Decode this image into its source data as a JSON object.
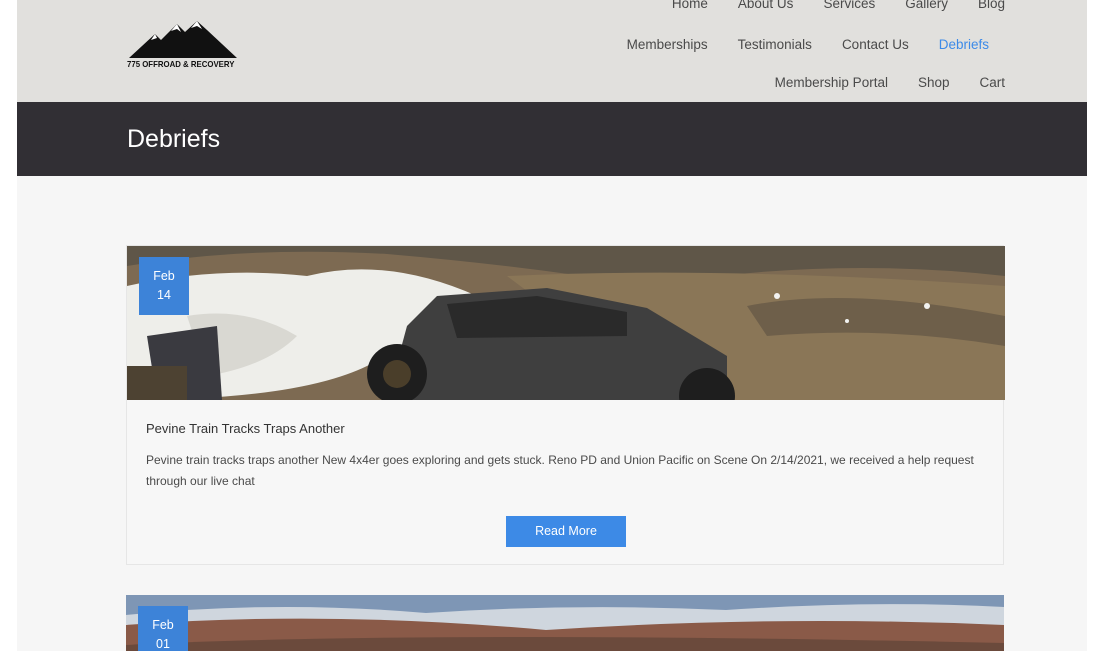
{
  "logo": {
    "text": "775 OFFROAD & RECOVERY"
  },
  "nav": {
    "row1": [
      "Home",
      "About Us",
      "Services",
      "Gallery",
      "Blog"
    ],
    "row2": [
      "Memberships",
      "Testimonials",
      "Contact Us",
      "Debriefs"
    ],
    "row3": [
      "Membership Portal",
      "Shop",
      "Cart"
    ],
    "active": "Debriefs"
  },
  "page_title": "Debriefs",
  "posts": [
    {
      "month": "Feb",
      "day": "14",
      "title": "Pevine Train Tracks Traps Another",
      "excerpt": "Pevine train tracks traps another New 4x4er goes exploring and gets stuck. Reno PD and Union Pacific on Scene On 2/14/2021, we received a help request through our live chat",
      "button": "Read More"
    },
    {
      "month": "Feb",
      "day": "01"
    }
  ],
  "colors": {
    "accent": "#3d8ae6",
    "header_bg": "#e1e0dd",
    "title_band": "#312f34"
  }
}
